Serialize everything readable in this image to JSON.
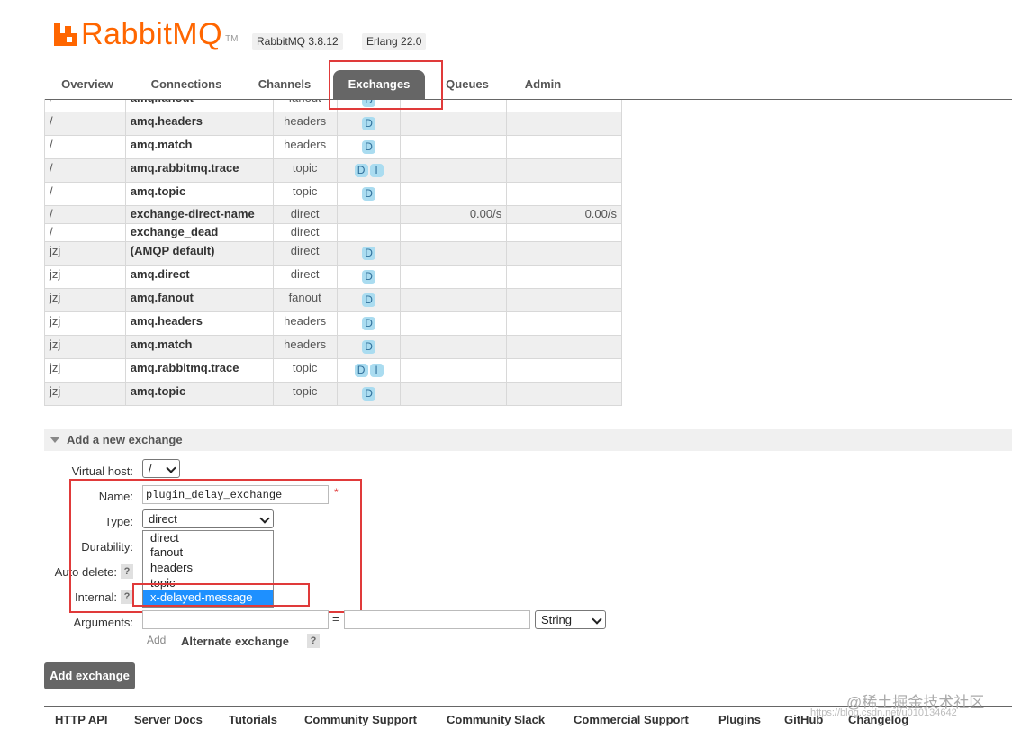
{
  "header": {
    "logo_text": "RabbitMQ",
    "logo_tm": "TM",
    "version_badge": "RabbitMQ 3.8.12",
    "erlang_badge": "Erlang 22.0"
  },
  "tabs": [
    {
      "label": "Overview"
    },
    {
      "label": "Connections"
    },
    {
      "label": "Channels"
    },
    {
      "label": "Exchanges",
      "active": true
    },
    {
      "label": "Queues"
    },
    {
      "label": "Admin"
    }
  ],
  "exchanges": {
    "rows": [
      {
        "vhost": "/",
        "name": "amq.fanout",
        "type": "fanout",
        "features": [
          "D"
        ],
        "rate_in": "",
        "rate_out": ""
      },
      {
        "vhost": "/",
        "name": "amq.headers",
        "type": "headers",
        "features": [
          "D"
        ],
        "rate_in": "",
        "rate_out": ""
      },
      {
        "vhost": "/",
        "name": "amq.match",
        "type": "headers",
        "features": [
          "D"
        ],
        "rate_in": "",
        "rate_out": ""
      },
      {
        "vhost": "/",
        "name": "amq.rabbitmq.trace",
        "type": "topic",
        "features": [
          "D",
          "I"
        ],
        "rate_in": "",
        "rate_out": ""
      },
      {
        "vhost": "/",
        "name": "amq.topic",
        "type": "topic",
        "features": [
          "D"
        ],
        "rate_in": "",
        "rate_out": ""
      },
      {
        "vhost": "/",
        "name": "exchange-direct-name",
        "type": "direct",
        "features": [],
        "rate_in": "0.00/s",
        "rate_out": "0.00/s"
      },
      {
        "vhost": "/",
        "name": "exchange_dead",
        "type": "direct",
        "features": [],
        "rate_in": "",
        "rate_out": ""
      },
      {
        "vhost": "jzj",
        "name": "(AMQP default)",
        "type": "direct",
        "features": [
          "D"
        ],
        "rate_in": "",
        "rate_out": ""
      },
      {
        "vhost": "jzj",
        "name": "amq.direct",
        "type": "direct",
        "features": [
          "D"
        ],
        "rate_in": "",
        "rate_out": ""
      },
      {
        "vhost": "jzj",
        "name": "amq.fanout",
        "type": "fanout",
        "features": [
          "D"
        ],
        "rate_in": "",
        "rate_out": ""
      },
      {
        "vhost": "jzj",
        "name": "amq.headers",
        "type": "headers",
        "features": [
          "D"
        ],
        "rate_in": "",
        "rate_out": ""
      },
      {
        "vhost": "jzj",
        "name": "amq.match",
        "type": "headers",
        "features": [
          "D"
        ],
        "rate_in": "",
        "rate_out": ""
      },
      {
        "vhost": "jzj",
        "name": "amq.rabbitmq.trace",
        "type": "topic",
        "features": [
          "D",
          "I"
        ],
        "rate_in": "",
        "rate_out": ""
      },
      {
        "vhost": "jzj",
        "name": "amq.topic",
        "type": "topic",
        "features": [
          "D"
        ],
        "rate_in": "",
        "rate_out": ""
      }
    ]
  },
  "add_exchange": {
    "section_title": "Add a new exchange",
    "virtual_host_label": "Virtual host:",
    "virtual_host_value": "/",
    "name_label": "Name:",
    "name_value": "plugin_delay_exchange",
    "required_mark": "*",
    "type_label": "Type:",
    "type_value": "direct",
    "type_options": [
      "direct",
      "fanout",
      "headers",
      "topic",
      "x-delayed-message"
    ],
    "type_highlighted": "x-delayed-message",
    "durability_label": "Durability:",
    "auto_delete_label": "Auto delete:",
    "internal_label": "Internal:",
    "help_mark": "?",
    "arguments_label": "Arguments:",
    "arguments_equals": "=",
    "arguments_type": "String",
    "add_link": "Add",
    "alternate_exchange": "Alternate exchange",
    "submit_label": "Add exchange"
  },
  "footer": {
    "links": [
      "HTTP API",
      "Server Docs",
      "Tutorials",
      "Community Support",
      "Community Slack",
      "Commercial Support",
      "Plugins",
      "GitHub",
      "Changelog"
    ]
  },
  "watermark": {
    "text": "@稀土掘金技术社区",
    "subtext": "https://blog.csdn.net/u010134642"
  },
  "colors": {
    "brand": "#ff6600",
    "tab_active_bg": "#666666",
    "highlight_box": "#e03a3a",
    "feature_badge": "#aadcf0",
    "selected_option": "#1e90ff"
  }
}
